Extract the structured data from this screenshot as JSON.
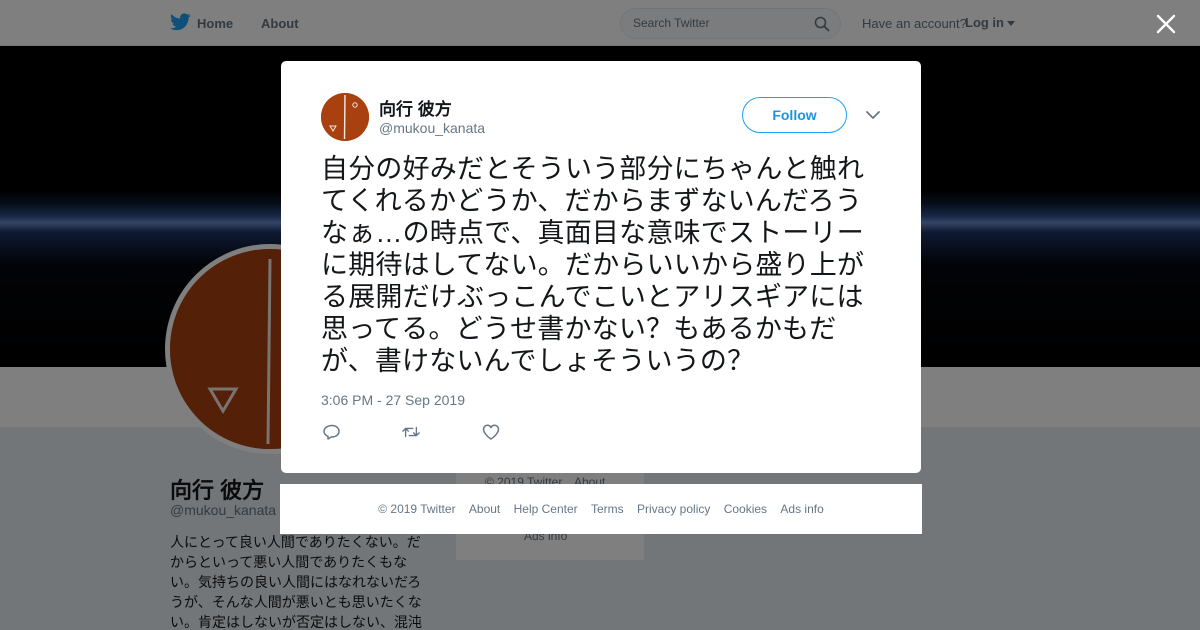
{
  "nav": {
    "home": "Home",
    "about": "About",
    "search_placeholder": "Search Twitter",
    "have_account": "Have an account?",
    "login": "Log in"
  },
  "profile": {
    "name": "向行 彼方",
    "handle": "@mukou_kanata",
    "bio": "人にとって良い人間でありたくない。だからといって悪い人間でありたくもない。気持ちの良い人間にはなれないだろうが、そんな人間が悪いとも思いたくない。肯定はしないが否定はしない、混沌"
  },
  "background_footer": {
    "copyright": "© 2019 Twitter",
    "about": "About",
    "ads_info": "Ads info"
  },
  "tweet": {
    "author_name": "向行 彼方",
    "author_handle": "@mukou_kanata",
    "follow_label": "Follow",
    "text": "自分の好みだとそういう部分にちゃんと触れてくれるかどうか、だからまずないんだろうなぁ…の時点で、真面目な意味でストーリーに期待はしてない。だからいいから盛り上がる展開だけぶっこんでこいとアリスギアには思ってる。どうせ書かない？もあるかもだが、書けないんでしょそういうの？",
    "timestamp": "3:06 PM - 27 Sep 2019"
  },
  "modal_footer": {
    "copyright": "© 2019 Twitter",
    "about": "About",
    "help_center": "Help Center",
    "terms": "Terms",
    "privacy": "Privacy policy",
    "cookies": "Cookies",
    "ads_info": "Ads info"
  },
  "colors": {
    "twitter_blue": "#1da1f2",
    "avatar_orange": "#a8400f",
    "page_bg": "#e6ecf0"
  }
}
